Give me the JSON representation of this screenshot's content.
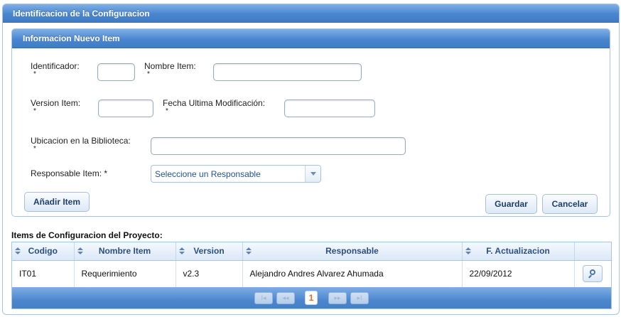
{
  "panel": {
    "title": "Identificacion de la Configuracion"
  },
  "form": {
    "title": "Informacion Nuevo Item",
    "required_mark": "*",
    "fields": {
      "identificador": {
        "label": "Identificador:",
        "value": ""
      },
      "nombre_item": {
        "label": "Nombre Item:",
        "value": ""
      },
      "version_item": {
        "label": "Version Item:",
        "value": ""
      },
      "fecha_modificacion": {
        "label": "Fecha Ultima Modificación:",
        "value": ""
      },
      "ubicacion": {
        "label": "Ubicacion en la Biblioteca:",
        "value": ""
      },
      "responsable": {
        "label": "Responsable Item: *",
        "selected": "Seleccione un Responsable"
      }
    },
    "buttons": {
      "add": "Añadir Item",
      "save": "Guardar",
      "cancel": "Cancelar"
    }
  },
  "grid": {
    "title": "Items de Configuracion del Proyecto:",
    "columns": [
      "Codigo",
      "Nombre Item",
      "Version",
      "Responsable",
      "F. Actualizacion",
      ""
    ],
    "rows": [
      {
        "codigo": "IT01",
        "nombre": "Requerimiento",
        "version": "v2.3",
        "responsable": "Alejandro Andres Alvarez Ahumada",
        "fecha": "22/09/2012",
        "action_icon": "magnifier-icon"
      }
    ],
    "pager": {
      "current_page": "1",
      "first": "I◂",
      "prev": "◂◂",
      "next": "▸▸",
      "last": "▸I"
    }
  },
  "colors": {
    "header_blue": "#4a86cf",
    "link_blue": "#24519a",
    "current_page": "#e06b1c"
  }
}
